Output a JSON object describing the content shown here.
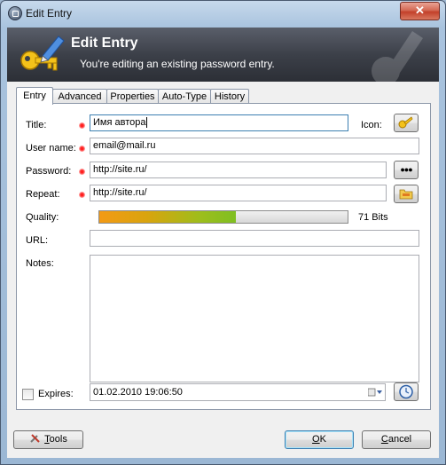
{
  "window": {
    "title": "Edit Entry",
    "close_glyph": "✕"
  },
  "banner": {
    "title": "Edit Entry",
    "subtitle": "You're editing an existing password entry.",
    "icon": "key-pen-icon"
  },
  "tabs": [
    {
      "label": "Entry",
      "active": true
    },
    {
      "label": "Advanced"
    },
    {
      "label": "Properties"
    },
    {
      "label": "Auto-Type"
    },
    {
      "label": "History"
    }
  ],
  "form": {
    "title_label": "Title:",
    "title_value": "Имя автора",
    "icon_label": "Icon:",
    "username_label": "User name:",
    "username_value": "email@mail.ru",
    "password_label": "Password:",
    "password_value": "http://site.ru/",
    "repeat_label": "Repeat:",
    "repeat_value": "http://site.ru/",
    "quality_label": "Quality:",
    "quality_percent": 55,
    "quality_text": "71 Bits",
    "url_label": "URL:",
    "url_value": "",
    "notes_label": "Notes:",
    "notes_value": "",
    "expires_label": "Expires:",
    "expires_checked": false,
    "expires_value": "01.02.2010 19:06:50",
    "show_password_glyph": "●●●"
  },
  "buttons": {
    "tools_underline": "T",
    "tools_rest": "ools",
    "ok_underline": "O",
    "ok_rest": "K",
    "cancel_underline": "C",
    "cancel_rest": "ancel"
  },
  "colors": {
    "banner": "#3c4049",
    "quality_start": "#f39a15",
    "quality_end": "#7fbf21",
    "required_marker": "#ff2020"
  }
}
